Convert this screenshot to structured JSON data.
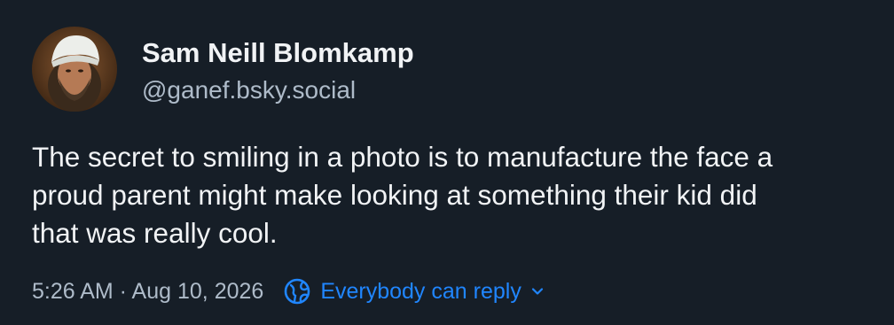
{
  "author": {
    "display_name": "Sam Neill Blomkamp",
    "handle": "@ganef.bsky.social",
    "avatar": "profile photo of person wearing a white head wrap"
  },
  "post": {
    "text_lines": [
      "The secret to smiling in a photo is to manufacture the face a",
      "proud parent might make looking at something their kid did",
      "that was really cool."
    ],
    "timestamp": "5:26 AM · Aug 10, 2026",
    "reply_setting": {
      "label": "Everybody can reply",
      "icon": "globe-icon",
      "dropdown_icon": "chevron-down-icon"
    }
  },
  "colors": {
    "background": "#161e27",
    "primary_text": "#f1f3f5",
    "secondary_text": "#aebbc9",
    "accent": "#2086ff"
  }
}
